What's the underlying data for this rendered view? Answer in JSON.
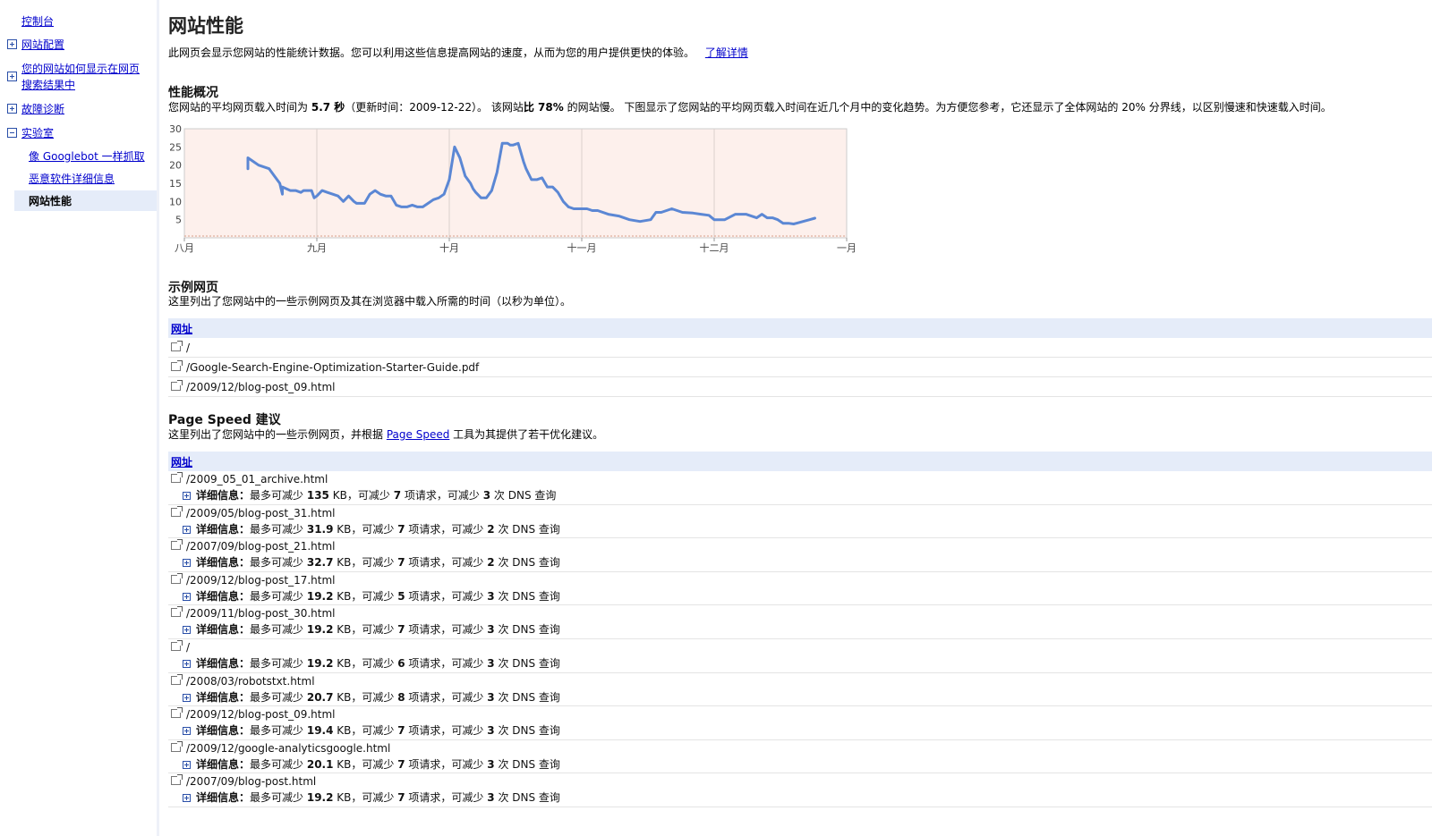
{
  "sidebar": {
    "items": [
      {
        "label": "控制台",
        "toggle": "none"
      },
      {
        "label": "网站配置",
        "toggle": "plus"
      },
      {
        "label": "您的网站如何显示在网页",
        "label2": "搜索结果中",
        "toggle": "plus"
      },
      {
        "label": "故障诊断",
        "toggle": "plus"
      },
      {
        "label": "实验室",
        "toggle": "minus"
      }
    ],
    "subitems": [
      "像 Googlebot 一样抓取",
      "恶意软件详细信息"
    ],
    "current": "网站性能"
  },
  "page": {
    "title": "网站性能",
    "intro": "此网页会显示您网站的性能统计数据。您可以利用这些信息提高网站的速度，从而为您的用户提供更快的体验。",
    "learn_more": "了解详情"
  },
  "overview": {
    "heading": "性能概况",
    "s1": "您网站的平均网页载入时间为",
    "load_time": "5.7 秒",
    "s2": "（更新时间：2009-12-22）。 该网站",
    "slower": "比 78%",
    "s3": "的网站慢。 下图显示了您网站的平均网页载入时间在近几个月中的变化趋势。为方便您参考，它还显示了全体网站的",
    "pct": "20%",
    "s4": "分界线，以区别慢速和快速载入时间。"
  },
  "chart_data": {
    "type": "line",
    "x_tick_labels": [
      "八月",
      "九月",
      "十月",
      "十一月",
      "十二月",
      "一月"
    ],
    "y_ticks": [
      5,
      10,
      15,
      20,
      25,
      30
    ],
    "ylim": [
      0,
      30
    ],
    "xlim": [
      0,
      5
    ],
    "grid": true,
    "background": "#fdf0ec",
    "line_color": "#5b87d4",
    "series": [
      {
        "x": [
          0.48,
          0.48,
          0.52,
          0.56,
          0.6,
          0.64,
          0.68,
          0.72,
          0.74,
          0.74,
          0.8,
          0.84,
          0.88,
          0.9,
          0.96,
          0.98,
          1.0,
          1.04,
          1.08,
          1.12,
          1.16,
          1.2,
          1.24,
          1.28,
          1.3,
          1.36,
          1.4,
          1.44,
          1.48,
          1.52,
          1.56,
          1.6,
          1.64,
          1.68,
          1.72,
          1.76,
          1.8,
          1.84,
          1.88,
          1.92,
          1.96,
          2.0,
          2.04,
          2.08,
          2.12,
          2.16,
          2.18,
          2.2,
          2.24,
          2.28,
          2.32,
          2.36,
          2.4,
          2.44,
          2.46,
          2.48,
          2.52,
          2.56,
          2.58,
          2.62,
          2.66,
          2.7,
          2.74,
          2.78,
          2.82,
          2.86,
          2.9,
          2.94,
          3.0,
          3.04,
          3.08,
          3.12,
          3.2,
          3.28,
          3.36,
          3.44,
          3.52,
          3.56,
          3.6,
          3.68,
          3.76,
          3.84,
          3.9,
          3.96,
          4.0,
          4.08,
          4.16,
          4.2,
          4.24,
          4.28,
          4.32,
          4.36,
          4.4,
          4.44,
          4.48,
          4.52,
          4.56,
          4.6,
          4.64,
          4.68,
          4.72,
          4.76
        ],
        "y": [
          19,
          22,
          21,
          20,
          19.5,
          19,
          17,
          15,
          12,
          14,
          13,
          13,
          12.5,
          13,
          13,
          11,
          11.5,
          13,
          12.5,
          12,
          11.5,
          10,
          11.5,
          10,
          9.5,
          9.5,
          12,
          13,
          12,
          11.5,
          11.5,
          9,
          8.5,
          8.5,
          9,
          8.5,
          8.5,
          9.5,
          10.5,
          11,
          12,
          16,
          25,
          22,
          17,
          15,
          13.5,
          12.5,
          11,
          11,
          13,
          18,
          26,
          26,
          25.5,
          25.5,
          26,
          21,
          19,
          16,
          16,
          16.5,
          14,
          14,
          12.5,
          10,
          8.5,
          8,
          8,
          8,
          7.5,
          7.5,
          6.5,
          6,
          5,
          4.5,
          5,
          7,
          7,
          8,
          7,
          6.8,
          6.5,
          6.2,
          5,
          5,
          6.5,
          6.5,
          6.5,
          6,
          5.5,
          6.5,
          5.5,
          5.5,
          5,
          4,
          4,
          3.8,
          4.2,
          4.6,
          5,
          5.4
        ]
      }
    ]
  },
  "samples": {
    "heading": "示例网页",
    "desc": "这里列出了您网站中的一些示例网页及其在浏览器中载入所需的时间（以秒为单位）。",
    "col_header": "网址",
    "rows": [
      "/",
      "/Google-Search-Engine-Optimization-Starter-Guide.pdf",
      "/2009/12/blog-post_09.html"
    ]
  },
  "pagespeed": {
    "heading": "Page Speed 建议",
    "desc1": "这里列出了您网站中的一些示例网页，并根据",
    "link": "Page Speed",
    "desc2": "工具为其提供了若干优化建议。",
    "col_header": "网址",
    "detail_label": "详细信息：",
    "t1": "最多可减少",
    "t2": "KB，可减少",
    "t3": "项请求，可减少",
    "t4": "次 DNS 查询",
    "rows": [
      {
        "url": "/2009_05_01_archive.html",
        "kb": "135",
        "req": "7",
        "dns": "3"
      },
      {
        "url": "/2009/05/blog-post_31.html",
        "kb": "31.9",
        "req": "7",
        "dns": "2"
      },
      {
        "url": "/2007/09/blog-post_21.html",
        "kb": "32.7",
        "req": "7",
        "dns": "2"
      },
      {
        "url": "/2009/12/blog-post_17.html",
        "kb": "19.2",
        "req": "5",
        "dns": "3"
      },
      {
        "url": "/2009/11/blog-post_30.html",
        "kb": "19.2",
        "req": "7",
        "dns": "3"
      },
      {
        "url": "/",
        "kb": "19.2",
        "req": "6",
        "dns": "3"
      },
      {
        "url": "/2008/03/robotstxt.html",
        "kb": "20.7",
        "req": "8",
        "dns": "3"
      },
      {
        "url": "/2009/12/blog-post_09.html",
        "kb": "19.4",
        "req": "7",
        "dns": "3"
      },
      {
        "url": "/2009/12/google-analyticsgoogle.html",
        "kb": "20.1",
        "req": "7",
        "dns": "3"
      },
      {
        "url": "/2007/09/blog-post.html",
        "kb": "19.2",
        "req": "7",
        "dns": "3"
      }
    ]
  }
}
